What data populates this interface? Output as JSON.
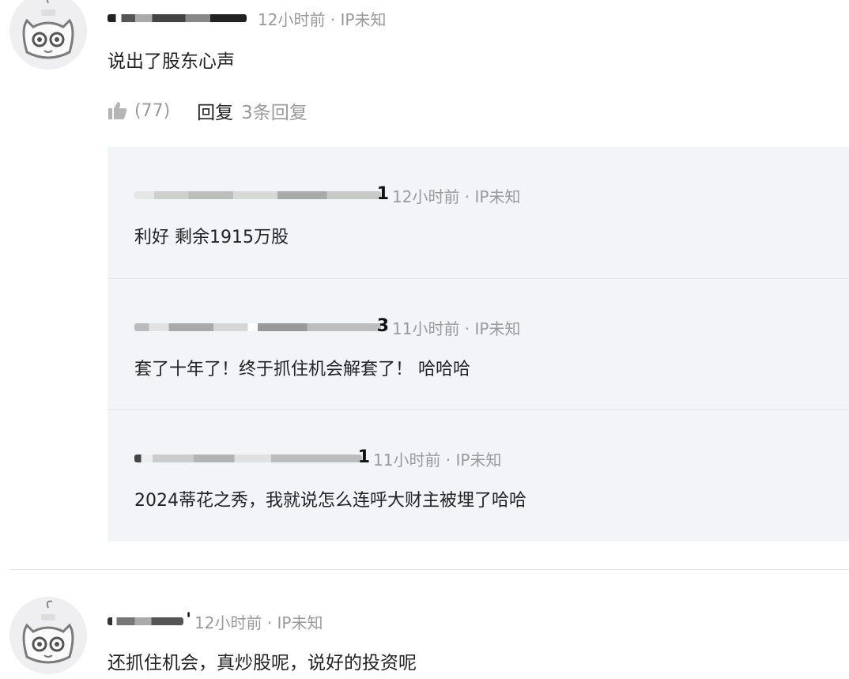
{
  "comments": [
    {
      "username_tail": "",
      "time": "12小时前 · IP未知",
      "text": "说出了股东心声",
      "likes": "(77)",
      "reply_label": "回复",
      "reply_count": "3条回复",
      "replies": [
        {
          "username_tail": "1",
          "time": "12小时前 · IP未知",
          "text": "利好 剩余1915万股"
        },
        {
          "username_tail": "3",
          "time": "11小时前 · IP未知",
          "text": "套了十年了！终于抓住机会解套了！  哈哈哈"
        },
        {
          "username_tail": "1",
          "time": "11小时前 · IP未知",
          "text": "2024蒂花之秀，我就说怎么连呼大财主被埋了哈哈"
        }
      ]
    },
    {
      "username_tail": "'",
      "time": "12小时前 · IP未知",
      "text": "还抓住机会，真炒股呢，说好的投资呢"
    }
  ],
  "icons": {
    "like": "thumbs-up-icon",
    "avatar": "cat-avatar-icon"
  },
  "colors": {
    "reply_background": "#f3f4f8",
    "muted_text": "#9a9a9a"
  }
}
